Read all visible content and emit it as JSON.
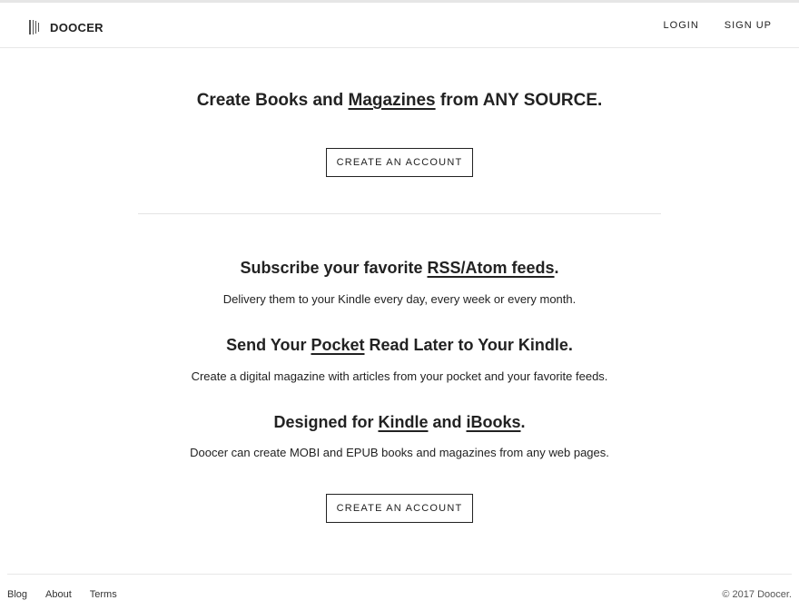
{
  "nav": {
    "brand": "DOOCER",
    "login": "LOGIN",
    "signup": "SIGN UP"
  },
  "hero": {
    "t1": "Create Books and ",
    "t2": "Magazines",
    "t3": " from ",
    "t4": "ANY SOURCE",
    "t5": ".",
    "cta": "CREATE AN ACCOUNT"
  },
  "features": [
    {
      "t1": "Subscribe your favorite ",
      "link": "RSS/Atom feeds",
      "t2": ".",
      "desc": "Delivery them to your Kindle every day, every week or every month."
    },
    {
      "t1": "Send Your ",
      "link": "Pocket",
      "t2": " Read Later to Your Kindle.",
      "desc": "Create a digital magazine with articles from your pocket and your favorite feeds."
    },
    {
      "t1": "Designed for ",
      "link": "Kindle",
      "t2": " and ",
      "link2": "iBooks",
      "t3": ".",
      "desc": "Doocer can create MOBI and EPUB books and magazines from any web pages."
    }
  ],
  "cta2": "CREATE AN ACCOUNT",
  "footer": {
    "links": [
      "Blog",
      "About",
      "Terms"
    ],
    "copyright": "© 2017 Doocer."
  },
  "icons": {
    "brand": "bars-logo-icon"
  }
}
